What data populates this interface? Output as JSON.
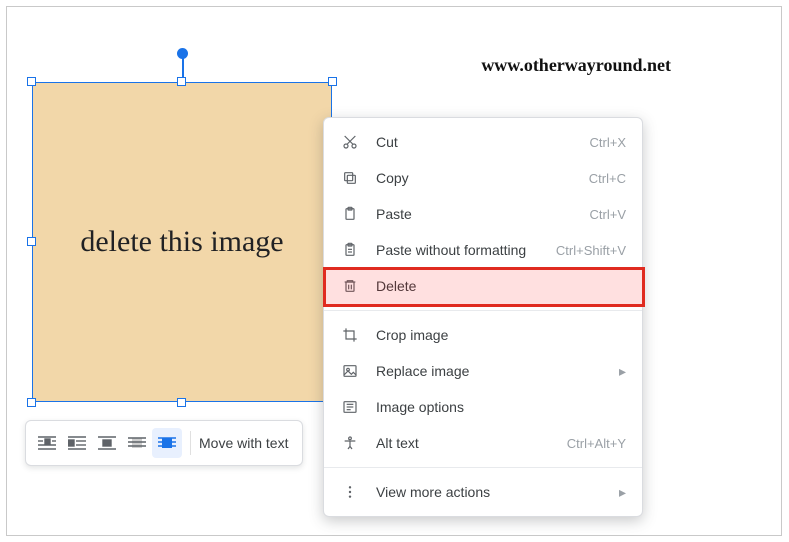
{
  "watermark": "www.otherwayround.net",
  "image_placeholder_text": "delete this image",
  "toolbar": {
    "move_label": "Move with text"
  },
  "context_menu": {
    "cut": {
      "label": "Cut",
      "shortcut": "Ctrl+X"
    },
    "copy": {
      "label": "Copy",
      "shortcut": "Ctrl+C"
    },
    "paste": {
      "label": "Paste",
      "shortcut": "Ctrl+V"
    },
    "paste_nf": {
      "label": "Paste without formatting",
      "shortcut": "Ctrl+Shift+V"
    },
    "delete": {
      "label": "Delete"
    },
    "crop": {
      "label": "Crop image"
    },
    "replace": {
      "label": "Replace image"
    },
    "img_opts": {
      "label": "Image options"
    },
    "alt_text": {
      "label": "Alt text",
      "shortcut": "Ctrl+Alt+Y"
    },
    "more": {
      "label": "View more actions"
    }
  }
}
